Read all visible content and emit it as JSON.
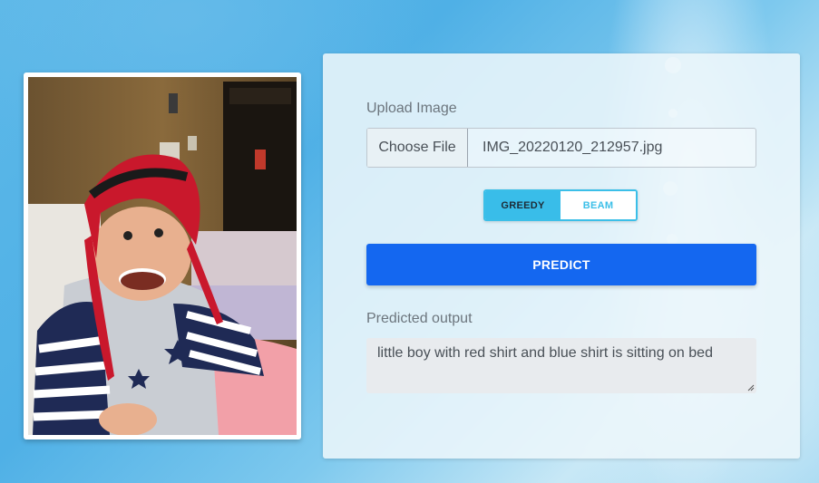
{
  "form": {
    "upload_label": "Upload Image",
    "choose_file_label": "Choose File",
    "file_name": "IMG_20220120_212957.jpg",
    "modes": [
      {
        "label": "GREEDY",
        "selected": true
      },
      {
        "label": "BEAM",
        "selected": false
      }
    ],
    "predict_label": "PREDICT",
    "output_label": "Predicted output",
    "output_text": "little boy with red shirt and blue shirt is sitting on bed"
  },
  "colors": {
    "accent": "#1467f0",
    "toggle_active": "#39bde9"
  }
}
